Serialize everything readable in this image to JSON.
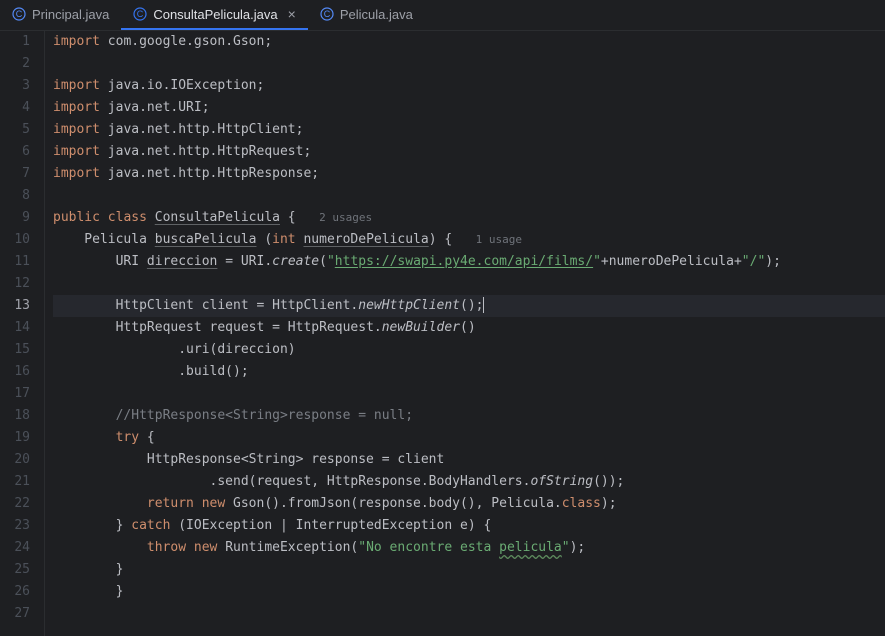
{
  "tabs": [
    {
      "label": "Principal.java",
      "active": false,
      "closable": false,
      "iconColor": "#9876aa"
    },
    {
      "label": "ConsultaPelicula.java",
      "active": true,
      "closable": true,
      "iconColor": "#3574f0"
    },
    {
      "label": "Pelicula.java",
      "active": false,
      "closable": false,
      "iconColor": "#9876aa"
    }
  ],
  "currentLine": 13,
  "hints": {
    "classUsages": "2 usages",
    "methodUsages": "1 usage"
  },
  "code": {
    "l1": {
      "kw": "import",
      "rest": " com.google.gson.Gson;"
    },
    "l3": {
      "kw": "import",
      "rest": " java.io.IOException;"
    },
    "l4": {
      "kw": "import",
      "rest": " java.net.URI;"
    },
    "l5": {
      "kw": "import",
      "rest": " java.net.http.HttpClient;"
    },
    "l6": {
      "kw": "import",
      "rest": " java.net.http.HttpRequest;"
    },
    "l7": {
      "kw": "import",
      "rest": " java.net.http.HttpResponse;"
    },
    "l9": {
      "a": "public class ",
      "name": "ConsultaPelicula",
      "b": " {"
    },
    "l10": {
      "a": "Pelicula ",
      "name": "buscaPelicula",
      "b": " (",
      "kw": "int",
      "c": " ",
      "param": "numeroDePelicula",
      "d": ") {"
    },
    "l11": {
      "a": "URI ",
      "var": "direccion",
      "b": " = URI.",
      "m": "create",
      "c": "(",
      "s1": "\"",
      "url": "https://swapi.py4e.com/api/films/",
      "s2": "\"",
      "d": "+numeroDePelicula+",
      "s3": "\"/\"",
      "e": ");"
    },
    "l13": {
      "a": "HttpClient client = HttpClient.",
      "m": "newHttpClient",
      "b": "();"
    },
    "l14": {
      "a": "HttpRequest request = HttpRequest.",
      "m": "newBuilder",
      "b": "()"
    },
    "l15": ".uri(direccion)",
    "l16": ".build();",
    "l18": "//HttpResponse<String>response = null;",
    "l19": {
      "kw": "try",
      "rest": " {"
    },
    "l20": "HttpResponse<String> response = client",
    "l21": {
      "a": ".send(request, HttpResponse.BodyHandlers.",
      "m": "ofString",
      "b": "());"
    },
    "l22": {
      "a": "return new ",
      "cls": "Gson",
      "b": "().fromJson(response.body(), Pelicula.",
      "kw": "class",
      "c": ");"
    },
    "l23": {
      "a": "} ",
      "kw": "catch",
      "b": " (IOException | InterruptedException e) {"
    },
    "l24": {
      "a": "throw new ",
      "cls": "RuntimeException",
      "b": "(",
      "s1": "\"No encontre esta ",
      "wavy": "pelicula",
      "s2": "\"",
      "c": ");"
    },
    "l25": "}",
    "l26": "}"
  }
}
